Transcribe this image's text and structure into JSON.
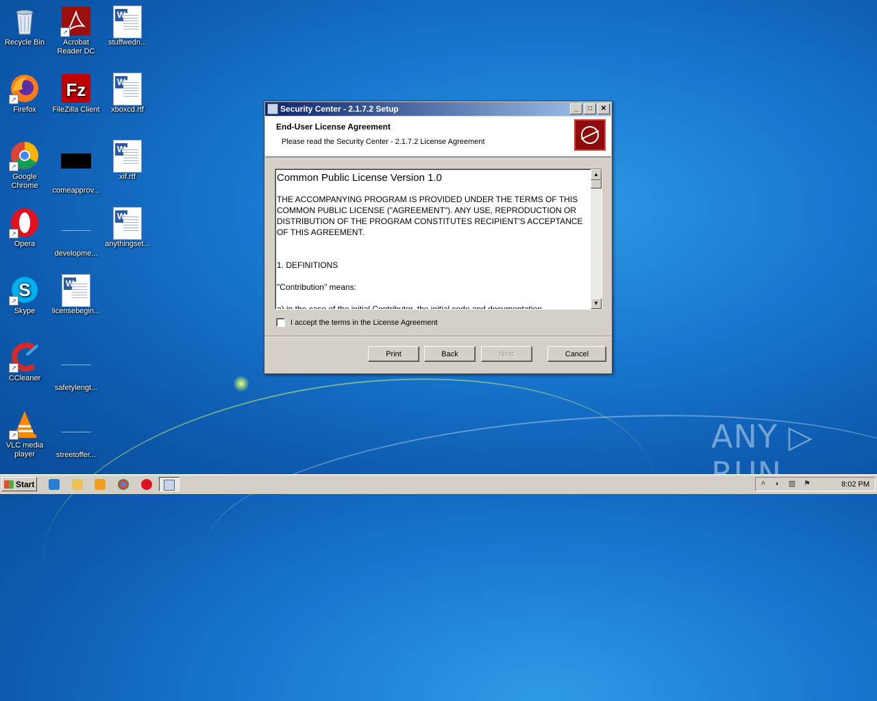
{
  "desktop": {
    "icons": [
      {
        "label": "Recycle Bin"
      },
      {
        "label": "Acrobat Reader DC"
      },
      {
        "label": "stuffwedn..."
      },
      {
        "label": "Firefox"
      },
      {
        "label": "FileZilla Client"
      },
      {
        "label": "xboxcd.rtf"
      },
      {
        "label": "Google Chrome"
      },
      {
        "label": "comeapprov..."
      },
      {
        "label": "xif.rtf"
      },
      {
        "label": "Opera"
      },
      {
        "label": "developme..."
      },
      {
        "label": "anythingset..."
      },
      {
        "label": "Skype"
      },
      {
        "label": "licensebegin..."
      },
      {
        "label": "CCleaner"
      },
      {
        "label": "safetylengt..."
      },
      {
        "label": "VLC media player"
      },
      {
        "label": "streetoffer..."
      }
    ],
    "watermark": "ANY ▷ RUN"
  },
  "dialog": {
    "title": "Security Center - 2.1.7.2 Setup",
    "heading": "End-User License Agreement",
    "subheading": "Please read the Security Center - 2.1.7.2 License Agreement",
    "license": {
      "title": "Common Public License Version 1.0",
      "paragraph1": "THE ACCOMPANYING PROGRAM IS PROVIDED UNDER THE TERMS OF THIS COMMON PUBLIC LICENSE (\"AGREEMENT\"). ANY USE, REPRODUCTION OR DISTRIBUTION OF THE PROGRAM CONSTITUTES RECIPIENT'S ACCEPTANCE OF THIS AGREEMENT.",
      "section1": "1. DEFINITIONS",
      "contribution": "\"Contribution\" means:",
      "partial": "a) in the case of the initial Contributor, the initial code and documentation"
    },
    "accept_label": "I accept the terms in the License Agreement",
    "accept_checked": false,
    "buttons": {
      "print": "Print",
      "back": "Back",
      "next": "Next",
      "cancel": "Cancel"
    },
    "title_buttons": {
      "minimize": "_",
      "maximize": "□",
      "close": "✕"
    }
  },
  "taskbar": {
    "start_label": "Start",
    "clock": "8:02 PM"
  }
}
